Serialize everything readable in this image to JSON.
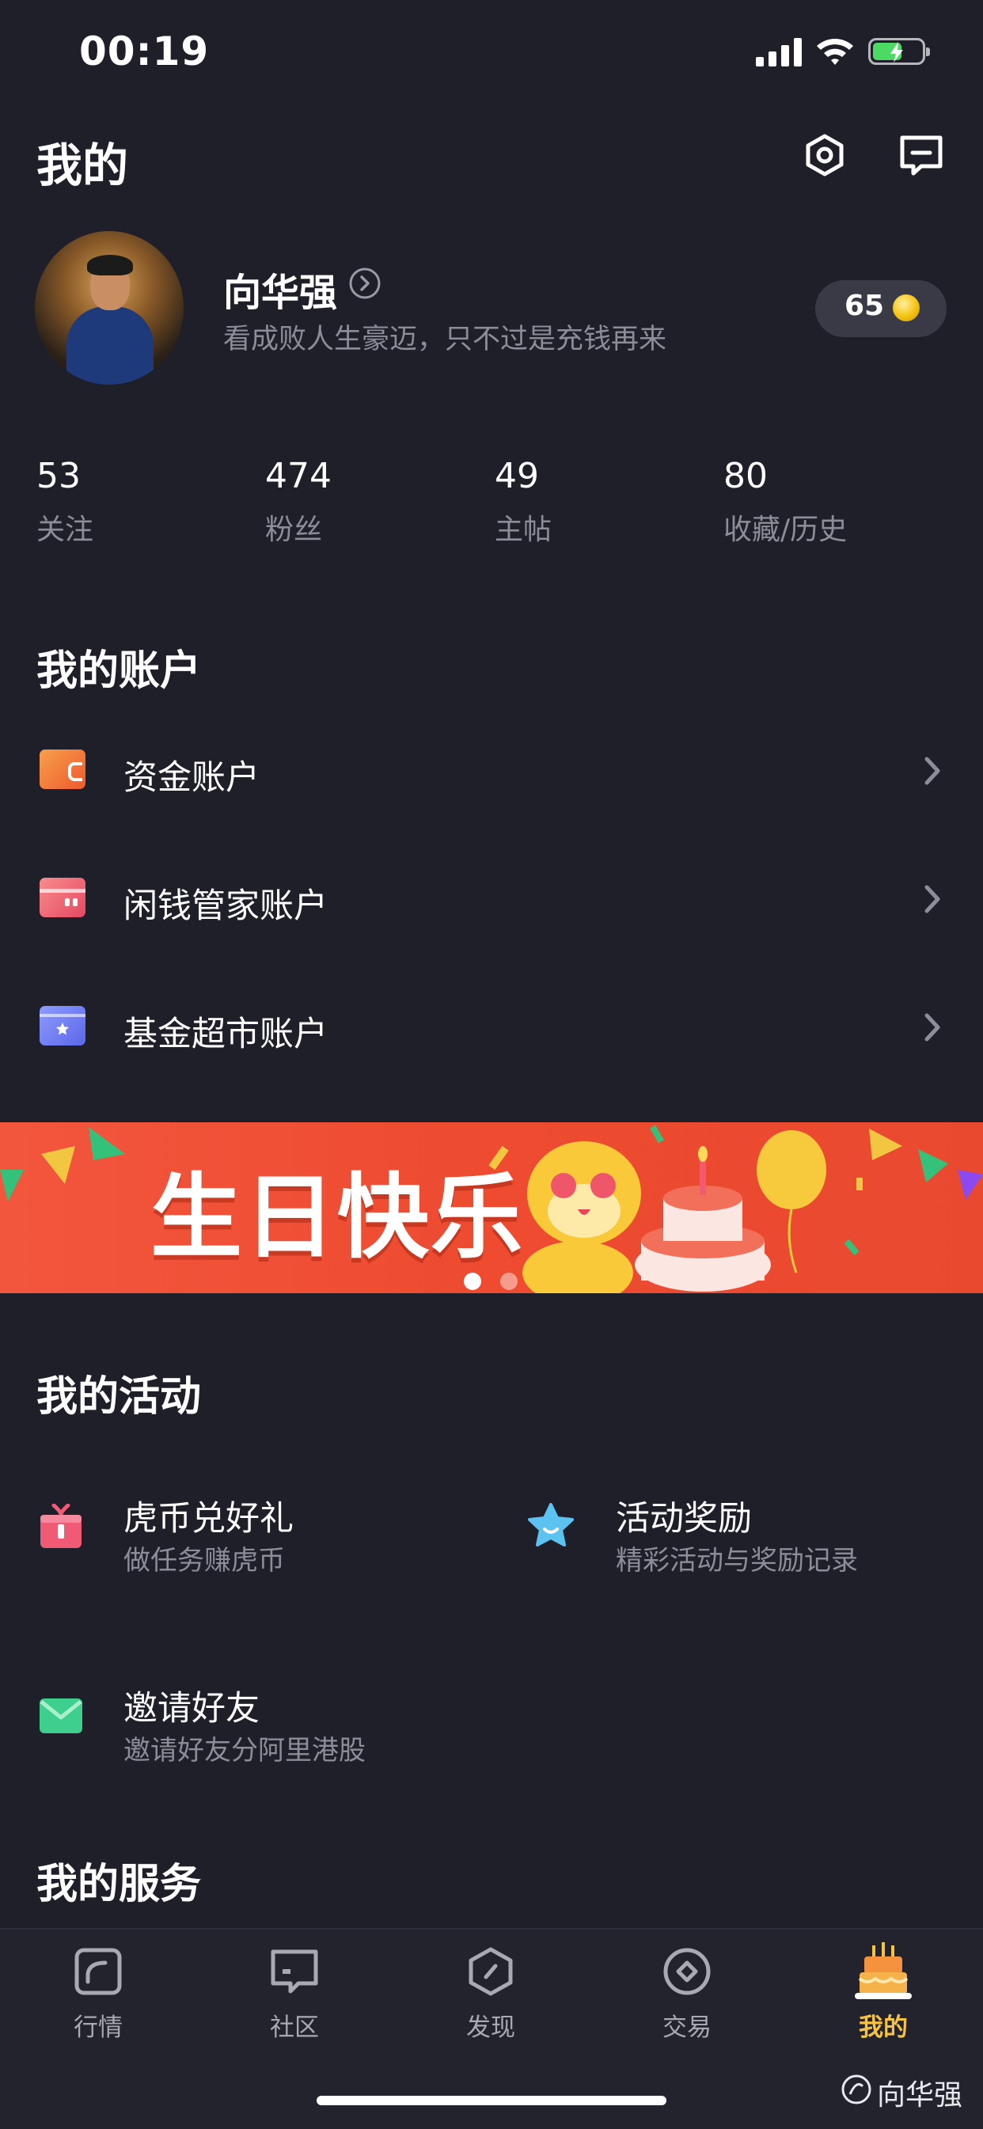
{
  "status_bar": {
    "time": "00:19"
  },
  "header": {
    "title": "我的"
  },
  "profile": {
    "name": "向华强",
    "bio": "看成败人生豪迈，只不过是充钱再来",
    "coins": "65"
  },
  "stats": [
    {
      "value": "53",
      "label": "关注"
    },
    {
      "value": "474",
      "label": "粉丝"
    },
    {
      "value": "49",
      "label": "主帖"
    },
    {
      "value": "80",
      "label": "收藏/历史"
    }
  ],
  "accounts": {
    "title": "我的账户",
    "items": [
      {
        "label": "资金账户",
        "icon": "wallet-icon",
        "color": "#f07a3a"
      },
      {
        "label": "闲钱管家账户",
        "icon": "card-icon",
        "color": "#ec5a6e"
      },
      {
        "label": "基金超市账户",
        "icon": "fund-icon",
        "color": "#6f7cf0"
      }
    ]
  },
  "banner": {
    "text": "生日快乐",
    "active_slide": 1,
    "slide_count": 2
  },
  "activities": {
    "title": "我的活动",
    "items": [
      {
        "title": "虎币兑好礼",
        "subtitle": "做任务赚虎币",
        "icon": "gift-icon"
      },
      {
        "title": "活动奖励",
        "subtitle": "精彩活动与奖励记录",
        "icon": "star-icon"
      },
      {
        "title": "邀请好友",
        "subtitle": "邀请好友分阿里港股",
        "icon": "envelope-icon"
      }
    ]
  },
  "services": {
    "title": "我的服务"
  },
  "tabbar": {
    "items": [
      {
        "label": "行情",
        "icon": "chart-icon"
      },
      {
        "label": "社区",
        "icon": "chat-icon"
      },
      {
        "label": "发现",
        "icon": "compass-icon"
      },
      {
        "label": "交易",
        "icon": "trade-icon"
      },
      {
        "label": "我的",
        "icon": "cake-icon",
        "active": true
      }
    ],
    "active_color": "#f5c242"
  },
  "watermark": "向华强"
}
